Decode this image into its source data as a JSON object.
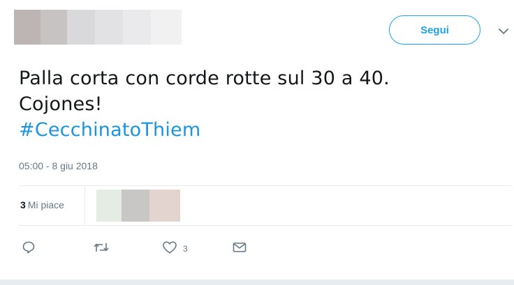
{
  "header": {
    "follow_label": "Segui"
  },
  "tweet": {
    "text_line1": "Palla corta con corde rotte sul 30 a 40.",
    "text_line2": "Cojones!",
    "hashtag": "#CecchinatoThiem",
    "timestamp": "05:00 - 8 giu 2018"
  },
  "stats": {
    "likes_count": "3",
    "likes_label": "Mi piace"
  },
  "actions": {
    "reply_icon": "reply-icon",
    "retweet_icon": "retweet-icon",
    "like_icon": "heart-icon",
    "like_count": "3",
    "dm_icon": "envelope-icon"
  },
  "colors": {
    "accent": "#1da1f2",
    "hashtag": "#1b95e0",
    "secondary_text": "#657786",
    "border": "#e6ecf0"
  }
}
